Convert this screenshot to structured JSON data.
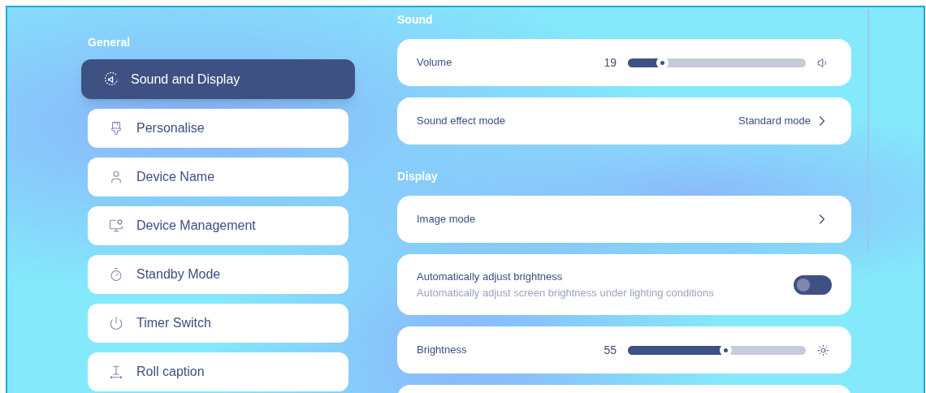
{
  "sidebar": {
    "heading": "General",
    "items": [
      {
        "label": "Sound and Display",
        "kind": "sound",
        "selected": true
      },
      {
        "label": "Personalise",
        "kind": "brush",
        "selected": false
      },
      {
        "label": "Device Name",
        "kind": "user",
        "selected": false
      },
      {
        "label": "Device Management",
        "kind": "monitor",
        "selected": false
      },
      {
        "label": "Standby Mode",
        "kind": "timer",
        "selected": false
      },
      {
        "label": "Timer Switch",
        "kind": "power",
        "selected": false
      },
      {
        "label": "Roll caption",
        "kind": "caption",
        "selected": false
      }
    ]
  },
  "sections": [
    {
      "heading": "Sound",
      "rows": [
        {
          "kind": "volume",
          "label": "Volume",
          "reading": "19",
          "level": 0.19
        },
        {
          "kind": "link",
          "label": "Sound effect mode",
          "value": "Standard mode"
        }
      ]
    },
    {
      "heading": "Display",
      "rows": [
        {
          "kind": "link",
          "label": "Image mode"
        },
        {
          "kind": "toggle",
          "label": "Automatically adjust brightness",
          "description": "Automatically adjust screen brightness under lighting conditions",
          "on": false
        },
        {
          "kind": "brightness",
          "label": "Brightness",
          "reading": "55",
          "level": 0.55
        },
        {
          "kind": "blank"
        }
      ]
    }
  ]
}
